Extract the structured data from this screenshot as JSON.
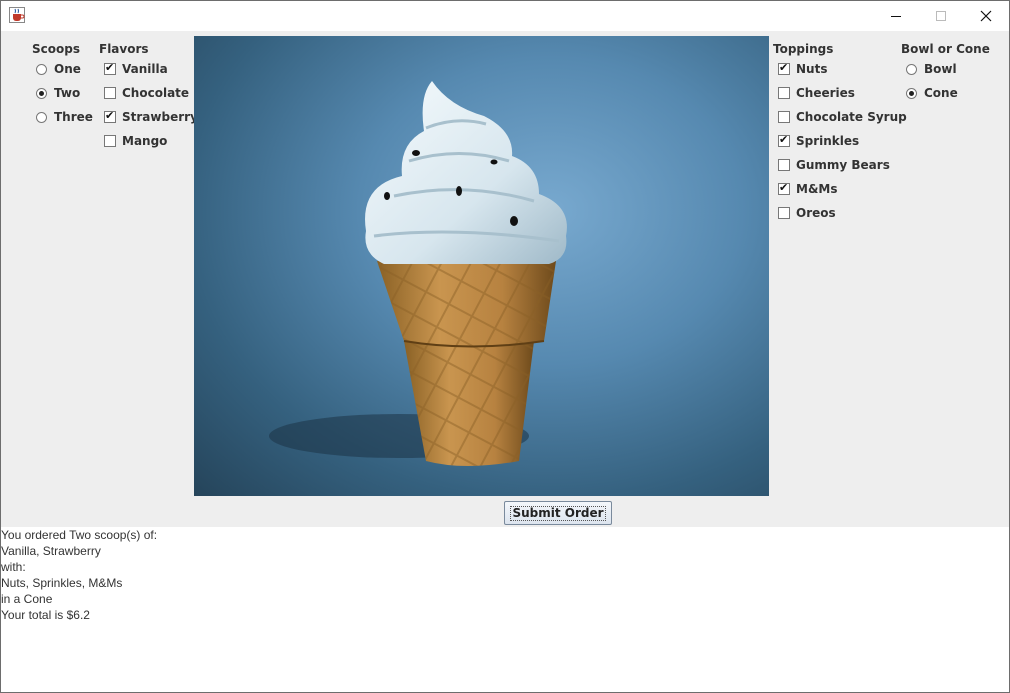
{
  "window": {
    "icon": "java-coffee-cup-icon"
  },
  "scoops": {
    "heading": "Scoops",
    "options": [
      {
        "label": "One",
        "selected": false
      },
      {
        "label": "Two",
        "selected": true
      },
      {
        "label": "Three",
        "selected": false
      }
    ]
  },
  "flavors": {
    "heading": "Flavors",
    "options": [
      {
        "label": "Vanilla",
        "checked": true
      },
      {
        "label": "Chocolate",
        "checked": false
      },
      {
        "label": "Strawberry",
        "checked": true
      },
      {
        "label": "Mango",
        "checked": false
      }
    ]
  },
  "image": {
    "description_icon": "ice-cream-cone-image"
  },
  "toppings": {
    "heading": "Toppings",
    "options": [
      {
        "label": "Nuts",
        "checked": true
      },
      {
        "label": "Cheeries",
        "checked": false
      },
      {
        "label": "Chocolate Syrup",
        "checked": false
      },
      {
        "label": "Sprinkles",
        "checked": true
      },
      {
        "label": "Gummy Bears",
        "checked": false
      },
      {
        "label": "M&Ms",
        "checked": true
      },
      {
        "label": "Oreos",
        "checked": false
      }
    ]
  },
  "container": {
    "heading": "Bowl or Cone",
    "options": [
      {
        "label": "Bowl",
        "selected": false
      },
      {
        "label": "Cone",
        "selected": true
      }
    ]
  },
  "submit_label": "Submit Order",
  "output": {
    "lines": [
      "You ordered Two scoop(s) of:",
      "Vanilla, Strawberry",
      "with:",
      "Nuts, Sprinkles, M&Ms",
      "in a Cone",
      "Your total is $6.2"
    ]
  },
  "colors": {
    "background": "#eeeeee",
    "output_background": "#ffffff",
    "image_background": "#4f7fa6"
  }
}
